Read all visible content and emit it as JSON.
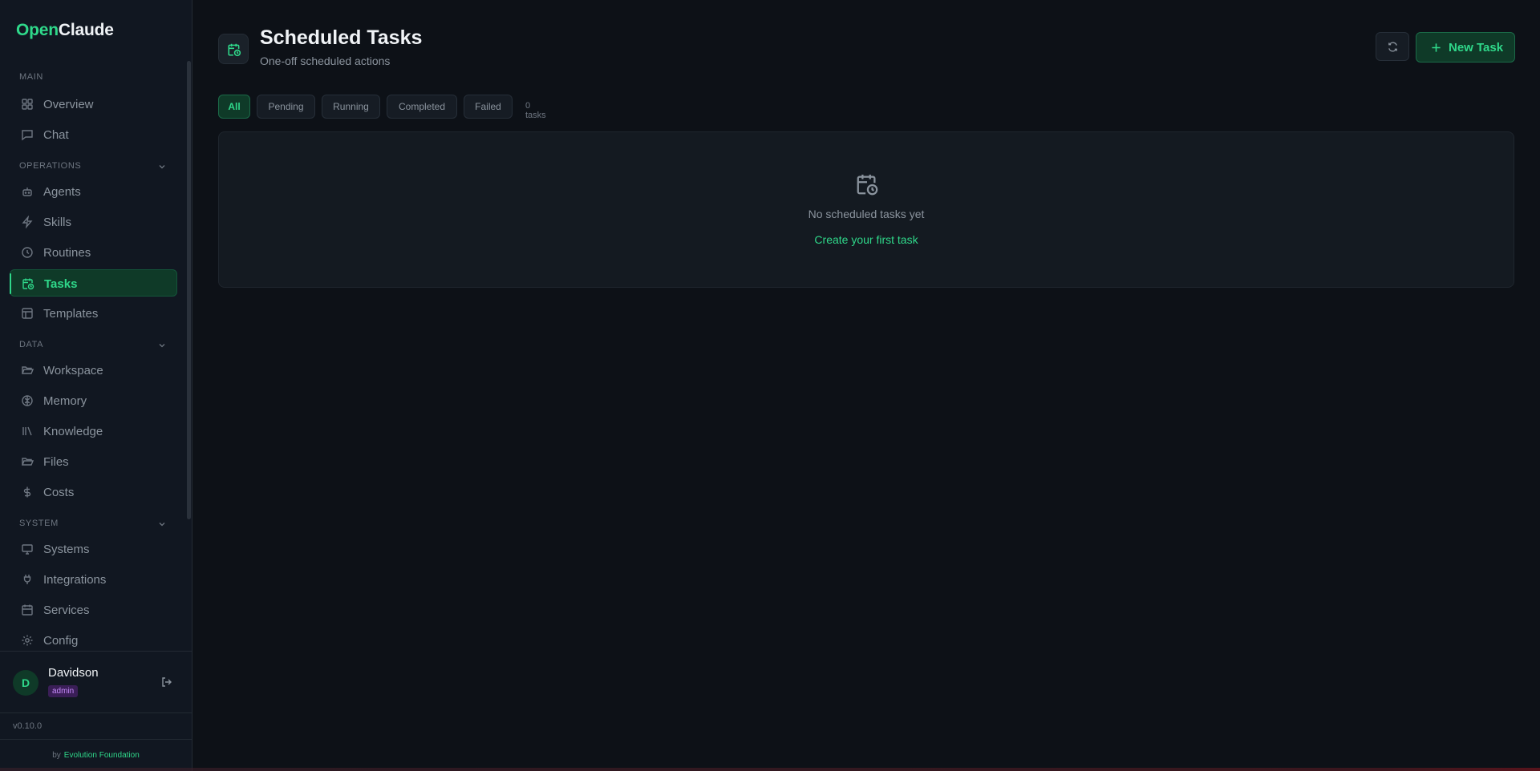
{
  "brand": {
    "part1": "Open",
    "part2": "Claude"
  },
  "sidebar": {
    "sections": {
      "main": "MAIN",
      "operations": "OPERATIONS",
      "data": "DATA",
      "system": "SYSTEM"
    },
    "items": {
      "overview": "Overview",
      "chat": "Chat",
      "agents": "Agents",
      "skills": "Skills",
      "routines": "Routines",
      "tasks": "Tasks",
      "templates": "Templates",
      "workspace": "Workspace",
      "memory": "Memory",
      "knowledge": "Knowledge",
      "files": "Files",
      "costs": "Costs",
      "systems": "Systems",
      "integrations": "Integrations",
      "services": "Services",
      "config": "Config"
    },
    "active_item": "Tasks"
  },
  "user": {
    "initial": "D",
    "name": "Davidson",
    "role": "admin"
  },
  "footer": {
    "version": "v0.10.0",
    "by": "by",
    "org": "Evolution Foundation"
  },
  "header": {
    "title": "Scheduled Tasks",
    "subtitle": "One-off scheduled actions",
    "new_task_label": "New Task"
  },
  "filters": {
    "all": "All",
    "pending": "Pending",
    "running": "Running",
    "completed": "Completed",
    "failed": "Failed",
    "active": "All",
    "count": "0 tasks"
  },
  "empty_state": {
    "message": "No scheduled tasks yet",
    "cta": "Create your first task"
  },
  "colors": {
    "accent": "#2fd88a",
    "background": "#0d1117",
    "sidebar": "#111721",
    "role_badge": "#c58af9"
  }
}
